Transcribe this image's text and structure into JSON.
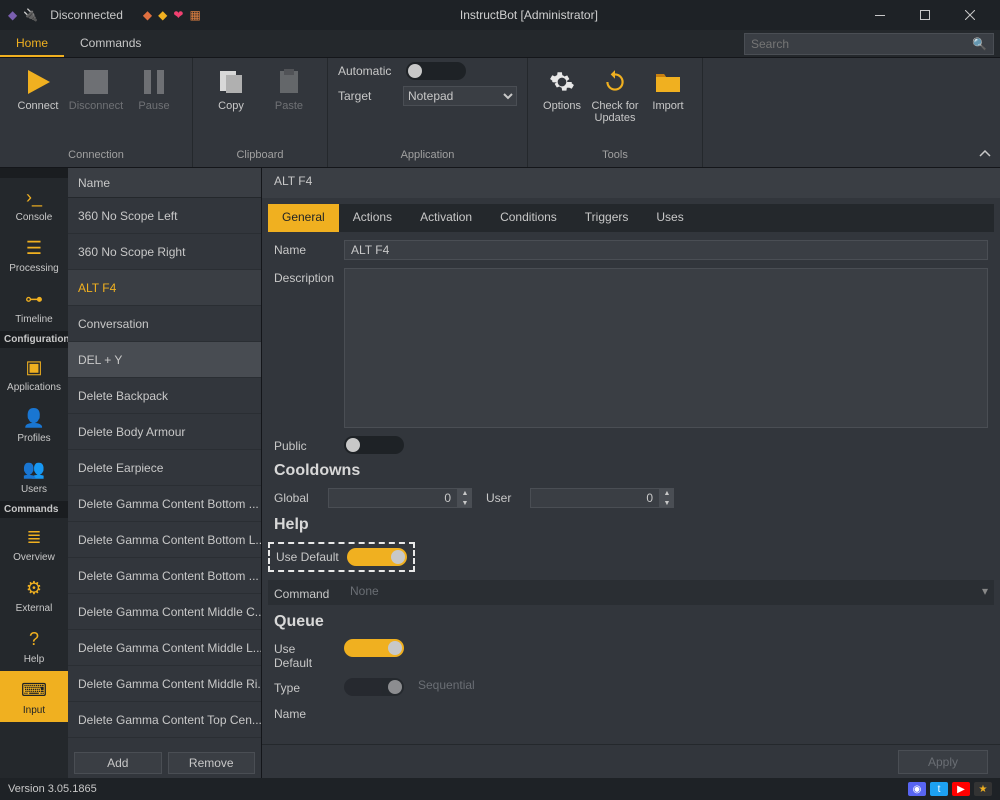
{
  "titlebar": {
    "status_text": "Disconnected",
    "title": "InstructBot [Administrator]"
  },
  "tabs": {
    "home": "Home",
    "commands": "Commands",
    "search_placeholder": "Search"
  },
  "ribbon": {
    "connect": "Connect",
    "disconnect": "Disconnect",
    "pause": "Pause",
    "copy": "Copy",
    "paste": "Paste",
    "automatic": "Automatic",
    "target": "Target",
    "target_value": "Notepad",
    "options": "Options",
    "check_updates": "Check for Updates",
    "import": "Import",
    "group_connection": "Connection",
    "group_clipboard": "Clipboard",
    "group_application": "Application",
    "group_tools": "Tools"
  },
  "nav": {
    "console": "Console",
    "processing": "Processing",
    "timeline": "Timeline",
    "section_configuration": "Configuration",
    "applications": "Applications",
    "profiles": "Profiles",
    "users": "Users",
    "section_commands": "Commands",
    "overview": "Overview",
    "external": "External",
    "help": "Help",
    "input": "Input"
  },
  "list": {
    "header": "Name",
    "items": [
      "360 No Scope Left",
      "360 No Scope Right",
      "ALT F4",
      "Conversation",
      "DEL + Y",
      "Delete Backpack",
      "Delete Body Armour",
      "Delete Earpiece",
      "Delete Gamma Content Bottom ...",
      "Delete Gamma Content Bottom L...",
      "Delete Gamma Content Bottom ...",
      "Delete Gamma Content Middle C...",
      "Delete Gamma Content Middle L...",
      "Delete Gamma Content Middle Ri...",
      "Delete Gamma Content Top Cen..."
    ],
    "selected_index": 2,
    "alt_selected_index": 4,
    "add": "Add",
    "remove": "Remove"
  },
  "content": {
    "header": "ALT F4",
    "tabs": [
      "General",
      "Actions",
      "Activation",
      "Conditions",
      "Triggers",
      "Uses"
    ],
    "active_tab": 0,
    "name_label": "Name",
    "name_value": "ALT F4",
    "description_label": "Description",
    "public_label": "Public",
    "section_cooldowns": "Cooldowns",
    "global_label": "Global",
    "global_value": "0",
    "user_label": "User",
    "user_value": "0",
    "section_help": "Help",
    "use_default_label": "Use Default",
    "command_label": "Command",
    "command_hint": "None",
    "section_queue": "Queue",
    "type_label": "Type",
    "type_hint": "Sequential",
    "queue_name_label": "Name",
    "apply": "Apply"
  },
  "statusbar": {
    "version": "Version 3.05.1865"
  }
}
